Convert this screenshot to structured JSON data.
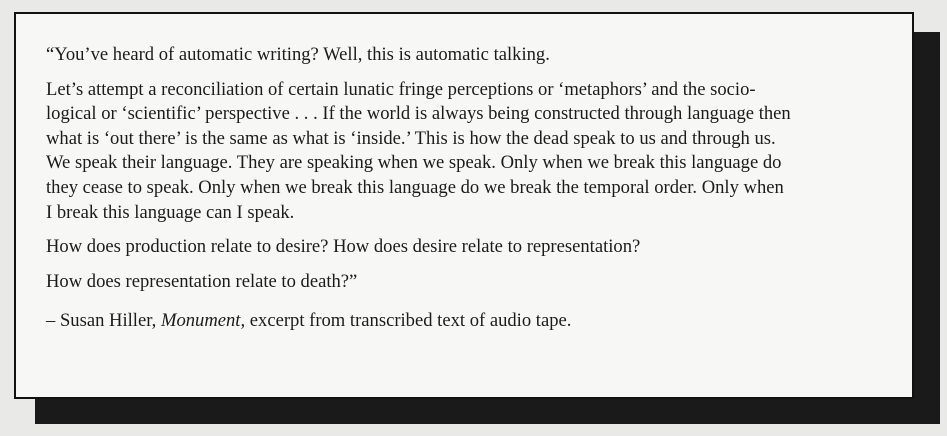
{
  "quote": {
    "line1": "“You’ve heard of automatic writing? Well, this is automatic talking.",
    "paragraph2": [
      "Let’s attempt a reconciliation of certain lunatic fringe perceptions or ‘metaphors’ and the socio-",
      "logical or ‘scientific’ perspective . . . If the world is always being constructed through language then",
      "what is ‘out there’ is the same as what is ‘inside.’ This is how the dead speak to us and through us.",
      "We speak their language. They are speaking when we speak. Only when we break this language do",
      "they cease to speak. Only when we break this language do we break the temporal order. Only when",
      "I break this language can I speak."
    ],
    "line3": "How does production relate to desire? How does desire relate to representation?",
    "line4": "How does representation relate to death?”"
  },
  "attribution": {
    "prefix": "– Susan Hiller, ",
    "work_title": "Monument,",
    "suffix": " excerpt from transcribed text of audio tape."
  }
}
